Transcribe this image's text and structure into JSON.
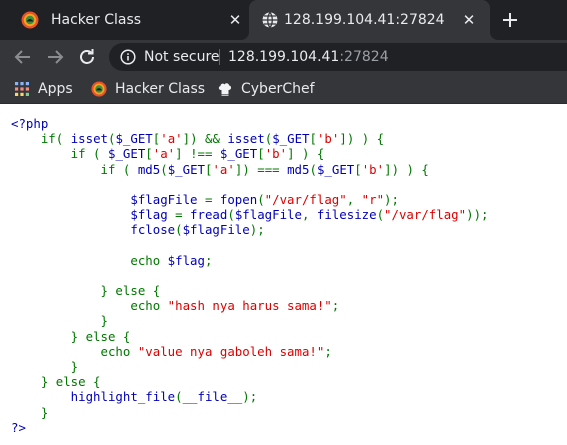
{
  "tabs": [
    {
      "title": "Hacker Class",
      "favicon": "hacker-class-favicon",
      "active": false
    },
    {
      "title": "128.199.104.41:27824",
      "favicon": "globe-icon",
      "active": true
    }
  ],
  "toolbar": {
    "security_label": "Not secure",
    "url_host": "128.199.104.41",
    "url_port": ":27824"
  },
  "bookmarks": [
    {
      "label": "Apps",
      "icon": "apps-grid-icon"
    },
    {
      "label": "Hacker Class",
      "icon": "hacker-class-favicon"
    },
    {
      "label": "CyberChef",
      "icon": "chef-hat-icon"
    }
  ],
  "code": {
    "language": "php",
    "lines": [
      [
        [
          "var",
          "<?php"
        ]
      ],
      [
        [
          "var",
          "    "
        ],
        [
          "kw",
          "if( "
        ],
        [
          "var",
          "isset"
        ],
        [
          "kw",
          "("
        ],
        [
          "var",
          "$_GET"
        ],
        [
          "kw",
          "["
        ],
        [
          "str",
          "'a'"
        ],
        [
          "kw",
          "]) && "
        ],
        [
          "var",
          "isset"
        ],
        [
          "kw",
          "("
        ],
        [
          "var",
          "$_GET"
        ],
        [
          "kw",
          "["
        ],
        [
          "str",
          "'b'"
        ],
        [
          "kw",
          "]) ) {"
        ]
      ],
      [
        [
          "kw",
          "        if ( "
        ],
        [
          "var",
          "$_GET"
        ],
        [
          "kw",
          "["
        ],
        [
          "str",
          "'a'"
        ],
        [
          "kw",
          "] !== "
        ],
        [
          "var",
          "$_GET"
        ],
        [
          "kw",
          "["
        ],
        [
          "str",
          "'b'"
        ],
        [
          "kw",
          "] ) {"
        ]
      ],
      [
        [
          "kw",
          "            if ( "
        ],
        [
          "var",
          "md5"
        ],
        [
          "kw",
          "("
        ],
        [
          "var",
          "$_GET"
        ],
        [
          "kw",
          "["
        ],
        [
          "str",
          "'a'"
        ],
        [
          "kw",
          "]) === "
        ],
        [
          "var",
          "md5"
        ],
        [
          "kw",
          "("
        ],
        [
          "var",
          "$_GET"
        ],
        [
          "kw",
          "["
        ],
        [
          "str",
          "'b'"
        ],
        [
          "kw",
          "]) ) {"
        ]
      ],
      [],
      [
        [
          "var",
          "                $flagFile "
        ],
        [
          "kw",
          "= "
        ],
        [
          "var",
          "fopen"
        ],
        [
          "kw",
          "("
        ],
        [
          "str",
          "\"/var/flag\""
        ],
        [
          "kw",
          ", "
        ],
        [
          "str",
          "\"r\""
        ],
        [
          "kw",
          ");"
        ]
      ],
      [
        [
          "var",
          "                $flag "
        ],
        [
          "kw",
          "= "
        ],
        [
          "var",
          "fread"
        ],
        [
          "kw",
          "("
        ],
        [
          "var",
          "$flagFile"
        ],
        [
          "kw",
          ", "
        ],
        [
          "var",
          "filesize"
        ],
        [
          "kw",
          "("
        ],
        [
          "str",
          "\"/var/flag\""
        ],
        [
          "kw",
          "));"
        ]
      ],
      [
        [
          "var",
          "                fclose"
        ],
        [
          "kw",
          "("
        ],
        [
          "var",
          "$flagFile"
        ],
        [
          "kw",
          ");"
        ]
      ],
      [],
      [
        [
          "kw",
          "                echo "
        ],
        [
          "var",
          "$flag"
        ],
        [
          "kw",
          ";"
        ]
      ],
      [],
      [
        [
          "kw",
          "            } else {"
        ]
      ],
      [
        [
          "kw",
          "                echo "
        ],
        [
          "str",
          "\"hash nya harus sama!\""
        ],
        [
          "kw",
          ";"
        ]
      ],
      [
        [
          "kw",
          "            }"
        ]
      ],
      [
        [
          "kw",
          "        } else {"
        ]
      ],
      [
        [
          "kw",
          "            echo "
        ],
        [
          "str",
          "\"value nya gaboleh sama!\""
        ],
        [
          "kw",
          ";"
        ]
      ],
      [
        [
          "kw",
          "        }"
        ]
      ],
      [
        [
          "kw",
          "    } else {"
        ]
      ],
      [
        [
          "var",
          "        highlight_file"
        ],
        [
          "kw",
          "("
        ],
        [
          "var",
          "__file__"
        ],
        [
          "kw",
          ");"
        ]
      ],
      [
        [
          "kw",
          "    }"
        ]
      ],
      [
        [
          "var",
          "?>"
        ]
      ]
    ]
  },
  "colors": {
    "tab_strip": "#202124",
    "toolbar": "#35363a",
    "php_default": "#0000bb",
    "php_keyword": "#007700",
    "php_string": "#dd0000"
  }
}
